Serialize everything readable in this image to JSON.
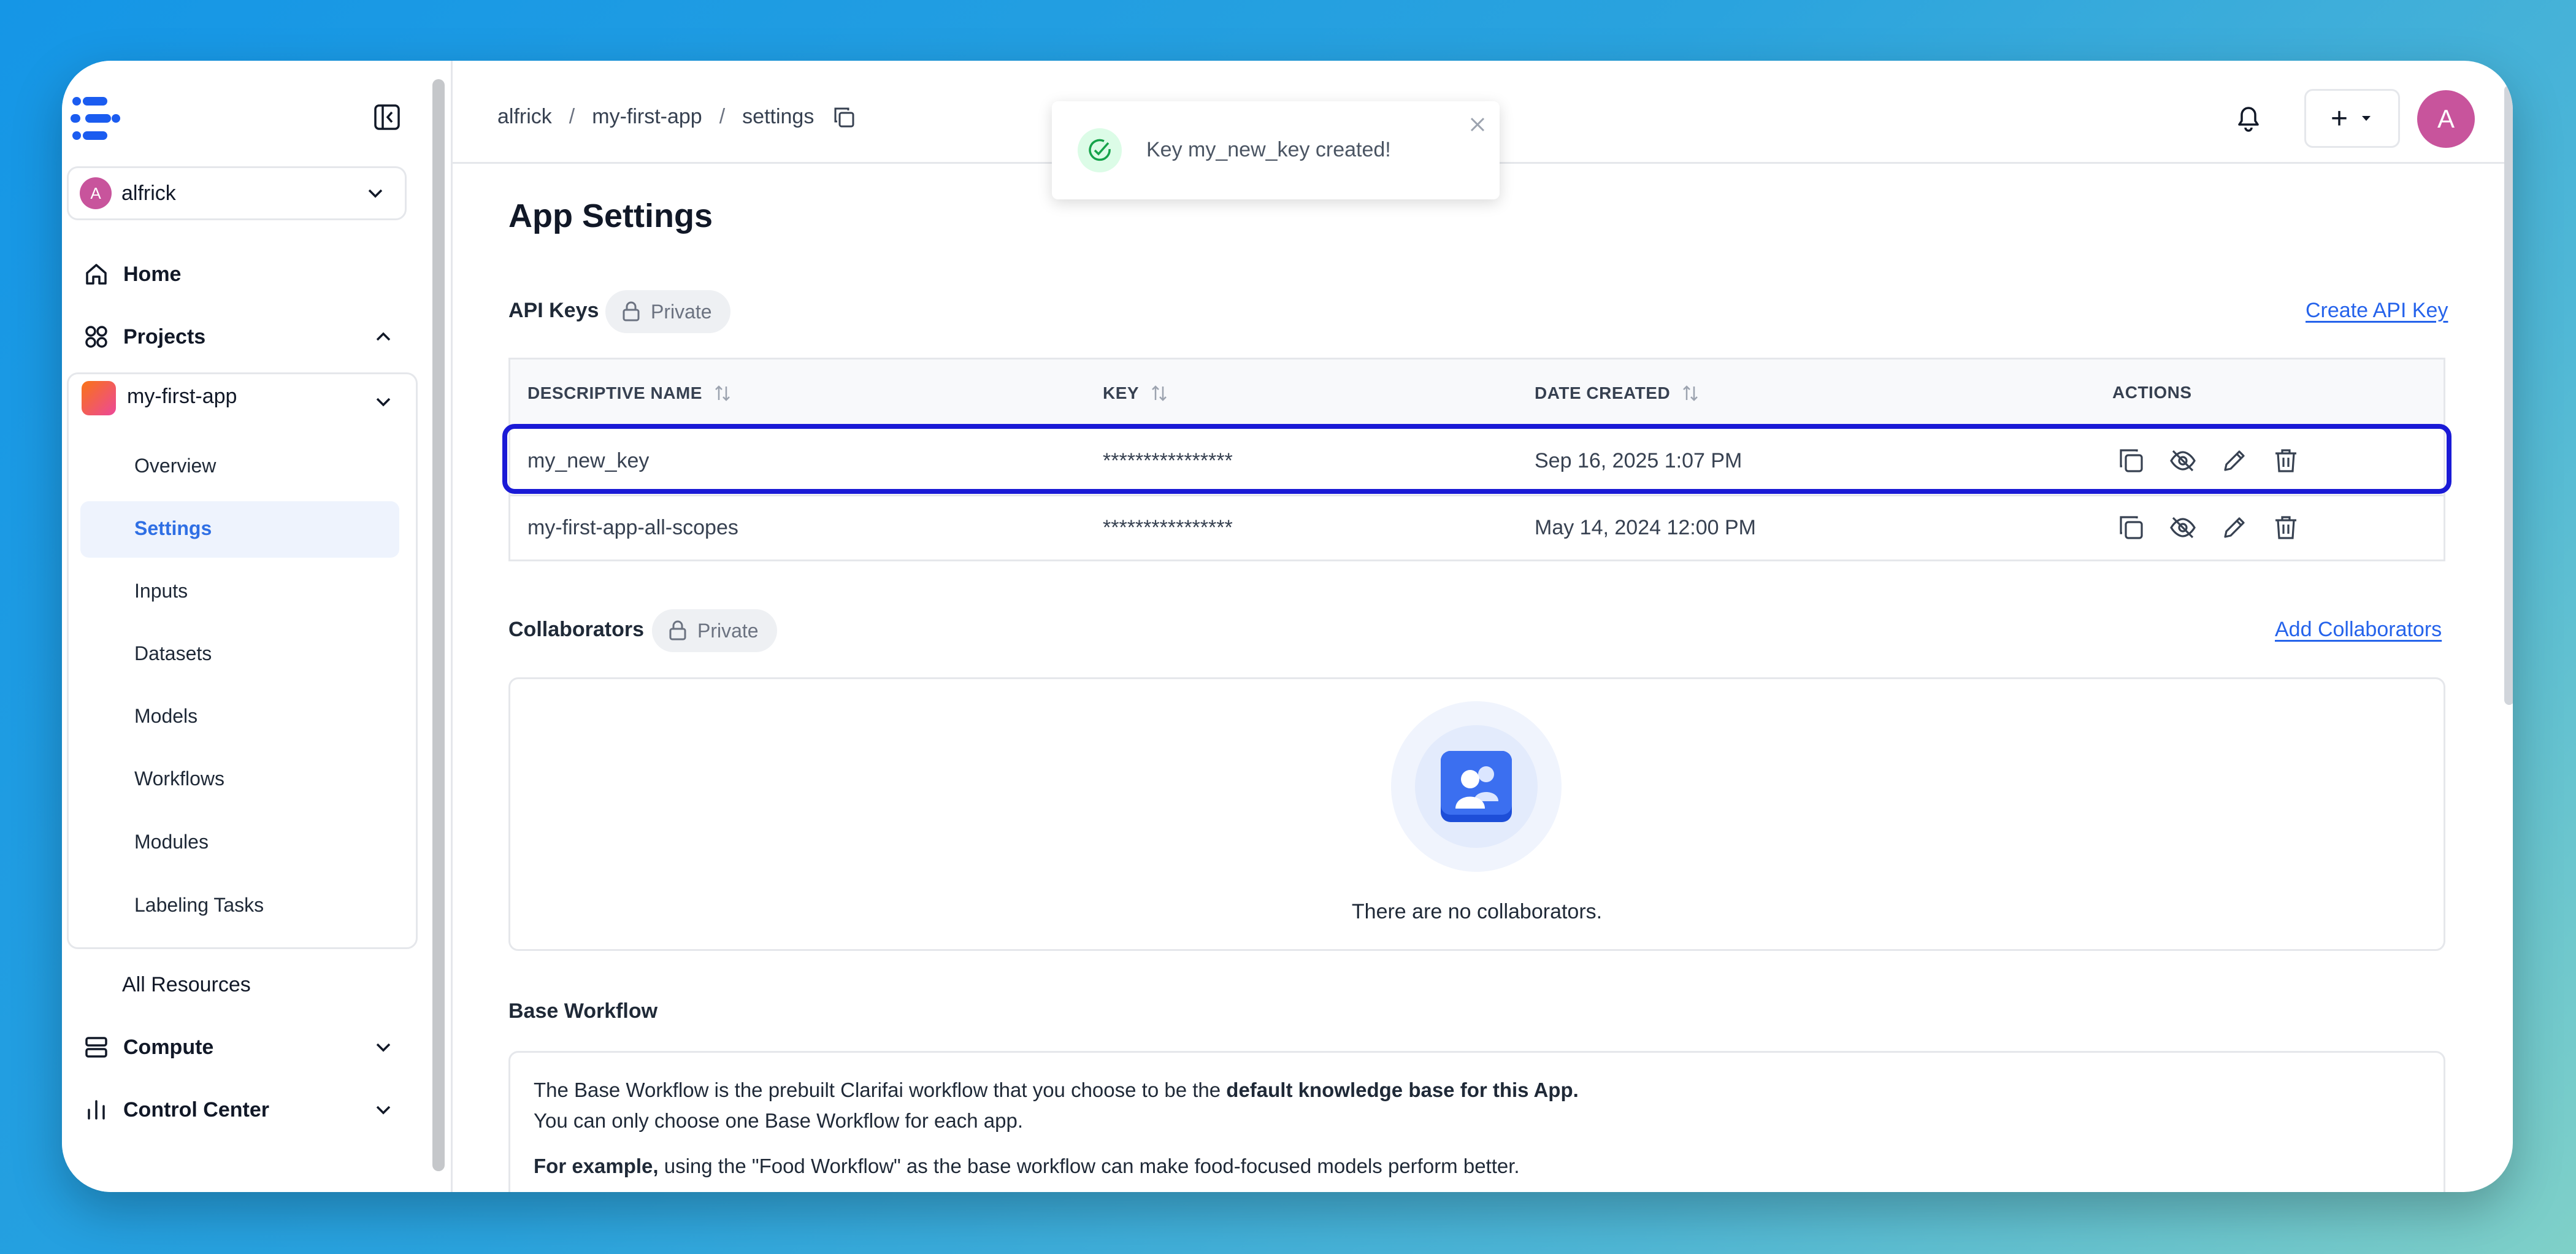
{
  "sidebar": {
    "org": {
      "avatar": "A",
      "name": "alfrick"
    },
    "nav": {
      "home": "Home",
      "projects": "Projects",
      "all_resources": "All Resources",
      "compute": "Compute",
      "control_center": "Control Center"
    },
    "app": {
      "name": "my-first-app",
      "items": [
        "Overview",
        "Settings",
        "Inputs",
        "Datasets",
        "Models",
        "Workflows",
        "Modules",
        "Labeling Tasks"
      ],
      "active": "Settings"
    },
    "icons": [
      "logo-icon",
      "collapse-sidebar-icon",
      "home-icon",
      "projects-grid-icon",
      "compute-icon",
      "bar-chart-icon",
      "chevron-down-icon",
      "chevron-up-icon"
    ]
  },
  "header": {
    "breadcrumb": [
      "alfrick",
      "my-first-app",
      "settings"
    ],
    "separator": "/",
    "plus_label": "+",
    "avatar": "A"
  },
  "toast": {
    "message": "Key my_new_key created!",
    "status_color": "#16a34a"
  },
  "page": {
    "title": "App Settings",
    "api_keys": {
      "label": "API Keys",
      "badge": "Private",
      "create_link": "Create API Key",
      "columns": [
        "DESCRIPTIVE NAME",
        "KEY",
        "DATE CREATED",
        "ACTIONS"
      ],
      "rows": [
        {
          "name": "my_new_key",
          "key": "****************",
          "date": "Sep 16, 2025 1:07 PM"
        },
        {
          "name": "my-first-app-all-scopes",
          "key": "****************",
          "date": "May 14, 2024 12:00 PM"
        }
      ],
      "highlight_color": "#1a1ad6"
    },
    "collaborators": {
      "label": "Collaborators",
      "badge": "Private",
      "add_link": "Add Collaborators",
      "empty_text": "There are no collaborators."
    },
    "base_workflow": {
      "label": "Base Workflow",
      "line1_a": "The Base Workflow is the prebuilt Clarifai workflow that you choose to be the ",
      "line1_b": "default knowledge base for this App.",
      "line2": "You can only choose one Base Workflow for each app.",
      "line3_a": "For example,",
      "line3_b": " using the \"Food Workflow\" as the base workflow can make food-focused models perform better."
    }
  },
  "colors": {
    "accent": "#2563eb",
    "avatar": "#c8549c",
    "active_bg": "#eef3fd"
  }
}
